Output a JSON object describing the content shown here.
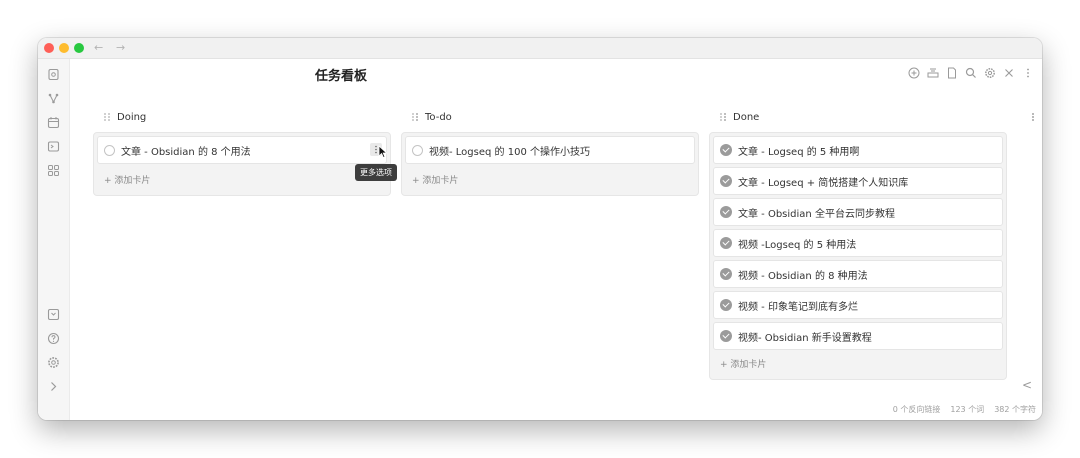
{
  "window": {
    "nav_back": "←",
    "nav_forward": "→"
  },
  "note": {
    "title": "任务看板"
  },
  "toolbar": {
    "icons": [
      "plus-circle-icon",
      "layout-icon",
      "file-icon",
      "search-icon",
      "gear-icon",
      "close-icon",
      "more-vertical-icon"
    ]
  },
  "ribbon": {
    "top_icons": [
      "open-file-icon",
      "graph-icon",
      "calendar-icon",
      "terminal-icon",
      "grid-icon"
    ],
    "bottom_icons": [
      "vault-icon",
      "help-icon",
      "settings-icon",
      "expand-icon"
    ]
  },
  "board": {
    "add_card_label": "+ 添加卡片",
    "lanes": [
      {
        "title": "Doing",
        "cards": [
          {
            "text": "文章 - Obsidian 的 8 个用法",
            "done": false
          }
        ]
      },
      {
        "title": "To-do",
        "cards": [
          {
            "text": "视频- Logseq 的 100 个操作小技巧",
            "done": false
          }
        ]
      },
      {
        "title": "Done",
        "cards": [
          {
            "text": "文章 - Logseq 的 5 种用啊",
            "done": true
          },
          {
            "text": "文章 - Logseq + 简悦搭建个人知识库",
            "done": true
          },
          {
            "text": "文章 - Obsidian 全平台云同步教程",
            "done": true
          },
          {
            "text": "视频 -Logseq 的 5 种用法",
            "done": true
          },
          {
            "text": "视频 - Obsidian 的 8 种用法",
            "done": true
          },
          {
            "text": "视频 - 印象笔记到底有多烂",
            "done": true
          },
          {
            "text": "视频- Obsidian 新手设置教程",
            "done": true
          }
        ]
      }
    ],
    "tooltip": "更多选项"
  },
  "status_bar": {
    "backlinks": "0 个反向链接",
    "words": "123 个词",
    "chars": "382 个字符"
  },
  "collapse_glyph": "<",
  "colors": {
    "close": "#fe5f57",
    "minimize": "#febc2e",
    "zoom": "#28c840",
    "done_check": "#9b9b9b"
  }
}
